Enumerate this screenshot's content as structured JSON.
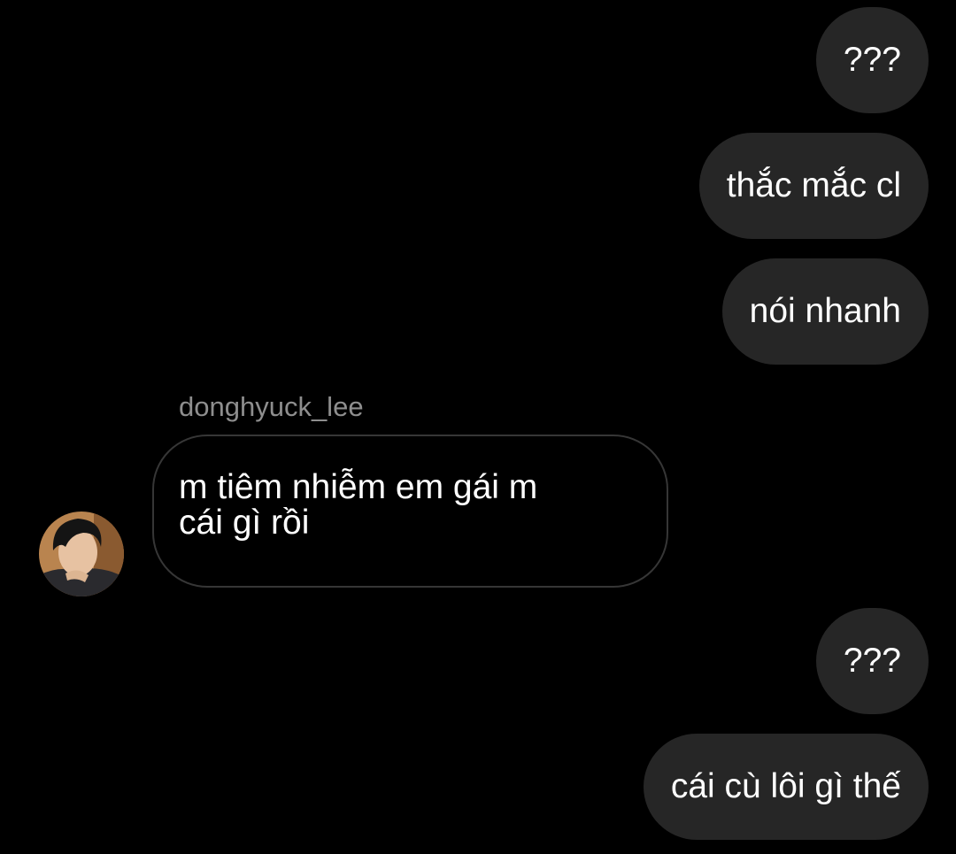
{
  "messages": [
    {
      "direction": "outgoing",
      "text": "???"
    },
    {
      "direction": "outgoing",
      "text": "thắc mắc cl"
    },
    {
      "direction": "outgoing",
      "text": "nói nhanh"
    },
    {
      "direction": "incoming",
      "sender": "donghyuck_lee",
      "lines": [
        "m tiêm nhiễm em gái m",
        "cái gì rồi"
      ]
    },
    {
      "direction": "outgoing",
      "text": "???"
    },
    {
      "direction": "outgoing",
      "text": "cái cù lôi gì thế"
    }
  ],
  "colors": {
    "background": "#000000",
    "outgoing_bubble": "#262626",
    "incoming_border": "#363636",
    "sender_name": "#8e8e8e",
    "text": "#ffffff"
  },
  "icons": {
    "avatar": "profile-photo"
  }
}
